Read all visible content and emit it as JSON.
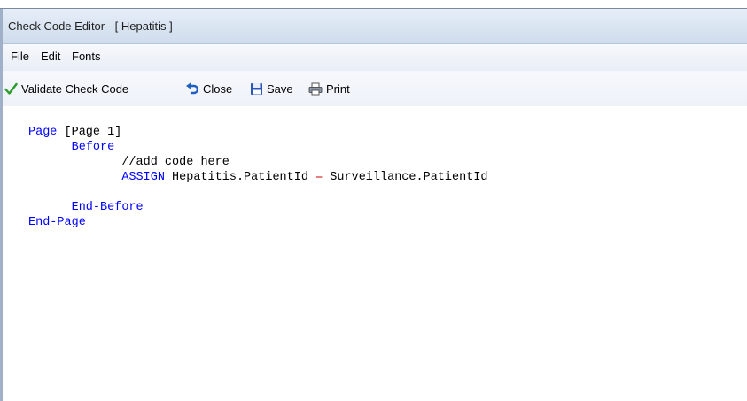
{
  "window": {
    "title": "Check Code Editor - [ Hepatitis ]"
  },
  "menu": {
    "file": "File",
    "edit": "Edit",
    "fonts": "Fonts"
  },
  "toolbar": {
    "validate": "Validate Check Code",
    "close": "Close",
    "save": "Save",
    "print": "Print"
  },
  "editor": {
    "line1_kw": "Page",
    "line1_rest": " [Page 1]",
    "before_kw": "Before",
    "comment": "//add code here",
    "assign_kw": "ASSIGN",
    "assign_lhs": " Hepatitis.PatientId ",
    "assign_op": "=",
    "assign_rhs": " Surveillance.PatientId",
    "end_before": "End-Before",
    "end_page": "End-Page"
  },
  "colors": {
    "keyword": "#0000ff",
    "operator": "#cc0000",
    "check_icon": "#2e9b2e",
    "close_icon": "#1f5fbf",
    "save_icon": "#2a56b8"
  },
  "icons": {
    "validate": "checkmark-icon",
    "close": "undo-arrow-icon",
    "save": "floppy-disk-icon",
    "print": "printer-icon"
  }
}
